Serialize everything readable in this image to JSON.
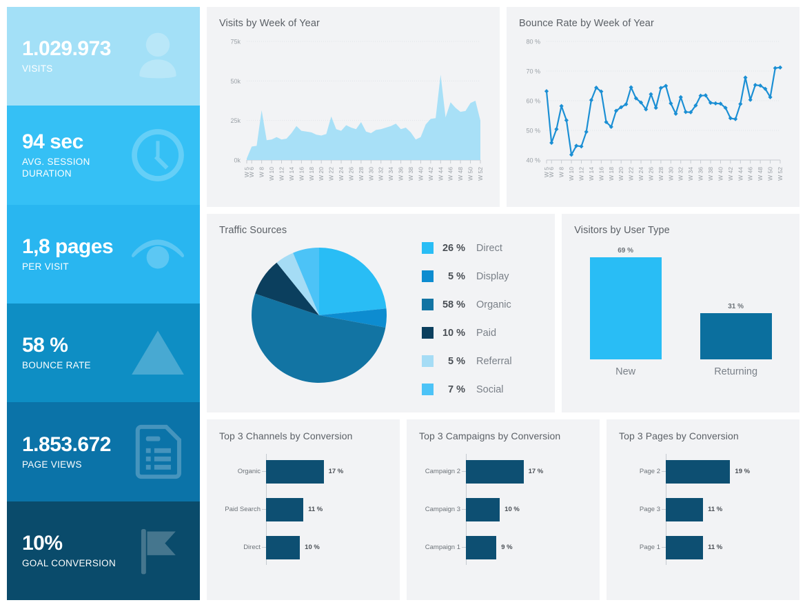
{
  "kpis": [
    {
      "value": "1.029.973",
      "label": "VISITS",
      "color": "#a3e0f7",
      "icon": "user-icon"
    },
    {
      "value": "94 sec",
      "label": "AVG. SESSION DURATION",
      "color": "#35c0f5",
      "icon": "clock-icon"
    },
    {
      "value": "1,8 pages",
      "label": "PER VISIT",
      "color": "#29b6f0",
      "icon": "eye-icon"
    },
    {
      "value": "58 %",
      "label": "BOUNCE RATE",
      "color": "#0e8ec4",
      "icon": "warning-icon"
    },
    {
      "value": "1.853.672",
      "label": "PAGE VIEWS",
      "color": "#0b73a8",
      "icon": "document-icon"
    },
    {
      "value": "10%",
      "label": "GOAL CONVERSION",
      "color": "#0a4b6b",
      "icon": "flag-icon"
    }
  ],
  "panels": {
    "visits_title": "Visits by Week of Year",
    "bounce_title": "Bounce Rate by Week of Year",
    "traffic_title": "Traffic Sources",
    "usertype_title": "Visitors by User Type",
    "channels_title": "Top 3 Channels by Conversion",
    "campaigns_title": "Top 3 Campaigns by Conversion",
    "pages_title": "Top 3 Pages by Conversion"
  },
  "chart_data": [
    {
      "id": "visits",
      "type": "area",
      "title": "Visits by Week of Year",
      "xlabel": "",
      "ylabel": "",
      "ylim": [
        0,
        75000
      ],
      "yticks": [
        0,
        25000,
        50000,
        75000
      ],
      "ytick_labels": [
        "0k",
        "25k",
        "50k",
        "75k"
      ],
      "grid": true,
      "color": "#a8e0f7",
      "x": [
        "W 5",
        "W 6",
        "W 7",
        "W 8",
        "W 9",
        "W 10",
        "W 11",
        "W 12",
        "W 13",
        "W 14",
        "W 15",
        "W 16",
        "W 17",
        "W 18",
        "W 19",
        "W 20",
        "W 21",
        "W 22",
        "W 23",
        "W 24",
        "W 25",
        "W 26",
        "W 27",
        "W 28",
        "W 29",
        "W 30",
        "W 31",
        "W 32",
        "W 33",
        "W 34",
        "W 35",
        "W 36",
        "W 37",
        "W 38",
        "W 39",
        "W 40",
        "W 41",
        "W 42",
        "W 43",
        "W 44",
        "W 45",
        "W 46",
        "W 47",
        "W 48",
        "W 49",
        "W 50",
        "W 51",
        "W 52"
      ],
      "xtick_labels": [
        "W 5",
        "W 6",
        "W 8",
        "W 10",
        "W 12",
        "W 14",
        "W 16",
        "W 18",
        "W 20",
        "W 22",
        "W 24",
        "W 26",
        "W 28",
        "W 30",
        "W 32",
        "W 34",
        "W 36",
        "W 38",
        "W 40",
        "W 42",
        "W 44",
        "W 46",
        "W 48",
        "W 50",
        "W 52"
      ],
      "values": [
        1000,
        8500,
        9000,
        31500,
        12500,
        13000,
        14500,
        13000,
        13500,
        17000,
        21500,
        18500,
        18000,
        17500,
        16000,
        15500,
        16500,
        27500,
        19500,
        18500,
        22000,
        20500,
        19500,
        24000,
        18000,
        17000,
        19000,
        19500,
        20500,
        21500,
        23000,
        19500,
        20500,
        17500,
        13000,
        14500,
        22500,
        26000,
        26500,
        54000,
        27000,
        36500,
        33000,
        30500,
        31000,
        36000,
        37500,
        25000
      ]
    },
    {
      "id": "bounce",
      "type": "line",
      "title": "Bounce Rate by Week of Year",
      "xlabel": "",
      "ylabel": "",
      "ylim": [
        40,
        80
      ],
      "yticks": [
        40,
        50,
        60,
        70,
        80
      ],
      "ytick_labels": [
        "40 %",
        "50 %",
        "60 %",
        "70 %",
        "80 %"
      ],
      "grid": true,
      "color": "#1b8fd4",
      "x": [
        "W 5",
        "W 6",
        "W 7",
        "W 8",
        "W 9",
        "W 10",
        "W 11",
        "W 12",
        "W 13",
        "W 14",
        "W 15",
        "W 16",
        "W 17",
        "W 18",
        "W 19",
        "W 20",
        "W 21",
        "W 22",
        "W 23",
        "W 24",
        "W 25",
        "W 26",
        "W 27",
        "W 28",
        "W 29",
        "W 30",
        "W 31",
        "W 32",
        "W 33",
        "W 34",
        "W 35",
        "W 36",
        "W 37",
        "W 38",
        "W 39",
        "W 40",
        "W 41",
        "W 42",
        "W 43",
        "W 44",
        "W 45",
        "W 46",
        "W 47",
        "W 48",
        "W 49",
        "W 50",
        "W 51",
        "W 52"
      ],
      "xtick_labels": [
        "W 5",
        "W 6",
        "W 8",
        "W 10",
        "W 12",
        "W 14",
        "W 16",
        "W 18",
        "W 20",
        "W 22",
        "W 24",
        "W 26",
        "W 28",
        "W 30",
        "W 32",
        "W 34",
        "W 36",
        "W 38",
        "W 40",
        "W 42",
        "W 44",
        "W 46",
        "W 48",
        "W 50",
        "W 52"
      ],
      "values": [
        63.2,
        45.8,
        50.4,
        58.2,
        53.4,
        41.8,
        44.8,
        44.6,
        49.5,
        60.2,
        64.4,
        63.1,
        52.8,
        51.2,
        56.6,
        57.8,
        58.8,
        64.5,
        60.8,
        59.4,
        57.1,
        62.2,
        57.6,
        64.3,
        65.0,
        59.1,
        55.6,
        61.2,
        56.2,
        56.1,
        58.4,
        61.7,
        61.8,
        59.3,
        59.1,
        59.0,
        57.6,
        54.1,
        53.8,
        58.9,
        67.8,
        60.3,
        65.3,
        65.1,
        64.0,
        61.2,
        71.0,
        71.2
      ]
    },
    {
      "id": "traffic_sources",
      "type": "pie",
      "title": "Traffic Sources",
      "labels": [
        "Direct",
        "Display",
        "Organic",
        "Paid",
        "Referral",
        "Social"
      ],
      "values": [
        26,
        5,
        58,
        10,
        5,
        7
      ],
      "value_labels": [
        "26 %",
        "5 %",
        "58 %",
        "10 %",
        "5 %",
        "7 %"
      ],
      "colors": [
        "#29bdf5",
        "#0d8cd0",
        "#1274a3",
        "#0b3f5e",
        "#a5dcf5",
        "#4cc3f7"
      ],
      "legend_position": "right"
    },
    {
      "id": "user_type",
      "type": "bar",
      "title": "Visitors by User Type",
      "categories": [
        "New",
        "Returning"
      ],
      "values": [
        69,
        31
      ],
      "value_labels": [
        "69 %",
        "31 %"
      ],
      "colors": [
        "#29bdf5",
        "#0b6f9e"
      ],
      "ylim": [
        0,
        80
      ]
    },
    {
      "id": "top_channels",
      "type": "bar",
      "orientation": "horizontal",
      "title": "Top 3 Channels by Conversion",
      "categories": [
        "Organic",
        "Paid Search",
        "Direct"
      ],
      "values": [
        17,
        11,
        10
      ],
      "value_labels": [
        "17 %",
        "11 %",
        "10 %"
      ],
      "color": "#0d4f72",
      "xlim": [
        0,
        24
      ]
    },
    {
      "id": "top_campaigns",
      "type": "bar",
      "orientation": "horizontal",
      "title": "Top 3 Campaigns by Conversion",
      "categories": [
        "Campaign 2",
        "Campaign 3",
        "Campaign 1"
      ],
      "values": [
        17,
        10,
        9
      ],
      "value_labels": [
        "17 %",
        "10 %",
        "9 %"
      ],
      "color": "#0d4f72",
      "xlim": [
        0,
        24
      ]
    },
    {
      "id": "top_pages",
      "type": "bar",
      "orientation": "horizontal",
      "title": "Top 3 Pages by Conversion",
      "categories": [
        "Page 2",
        "Page 3",
        "Page 1"
      ],
      "values": [
        19,
        11,
        11
      ],
      "value_labels": [
        "19 %",
        "11 %",
        "11 %"
      ],
      "color": "#0d4f72",
      "xlim": [
        0,
        24
      ]
    }
  ]
}
